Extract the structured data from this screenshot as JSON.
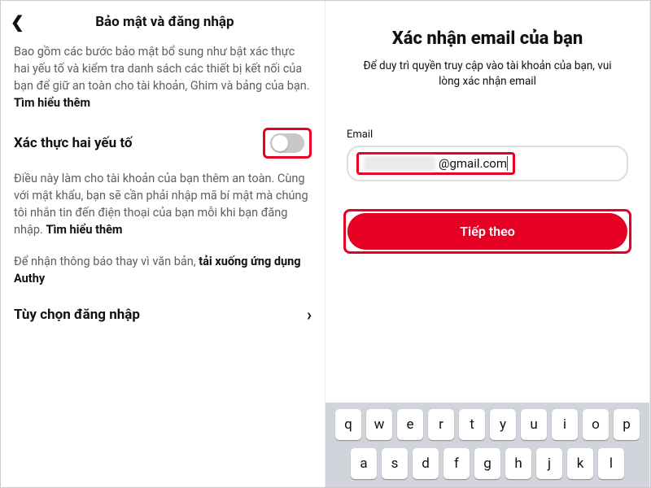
{
  "left": {
    "header_title": "Bảo mật và đăng nhập",
    "intro_text": "Bao gồm các bước bảo mật bổ sung như bật xác thực hai yếu tố và kiểm tra danh sách các thiết bị kết nối của bạn để giữ an toàn cho tài khoản, Ghim và bảng của bạn. ",
    "intro_link": "Tìm hiểu thêm",
    "two_factor_label": "Xác thực hai yếu tố",
    "two_factor_desc": "Điều này làm cho tài khoản của bạn thêm an toàn. Cùng với mật khẩu, bạn sẽ cần phải nhập mã bí mật mà chúng tôi nhắn tin đến điện thoại của bạn mỗi khi bạn đăng nhập. ",
    "two_factor_link": "Tìm hiểu thêm",
    "authy_text": "Để nhận thông báo thay vì văn bản, ",
    "authy_link": "tải xuống ứng dụng Authy",
    "login_options": "Tùy chọn đăng nhập"
  },
  "right": {
    "title": "Xác nhận email của bạn",
    "subtitle": "Để duy trì quyền truy cập vào tài khoản của bạn, vui lòng xác nhận email",
    "email_label": "Email",
    "email_visible": "@gmail.com",
    "next_label": "Tiếp theo"
  },
  "keyboard": {
    "row1": [
      "q",
      "w",
      "e",
      "r",
      "t",
      "y",
      "u",
      "i",
      "o",
      "p"
    ],
    "row2": [
      "a",
      "s",
      "d",
      "f",
      "g",
      "h",
      "j",
      "k",
      "l"
    ]
  }
}
